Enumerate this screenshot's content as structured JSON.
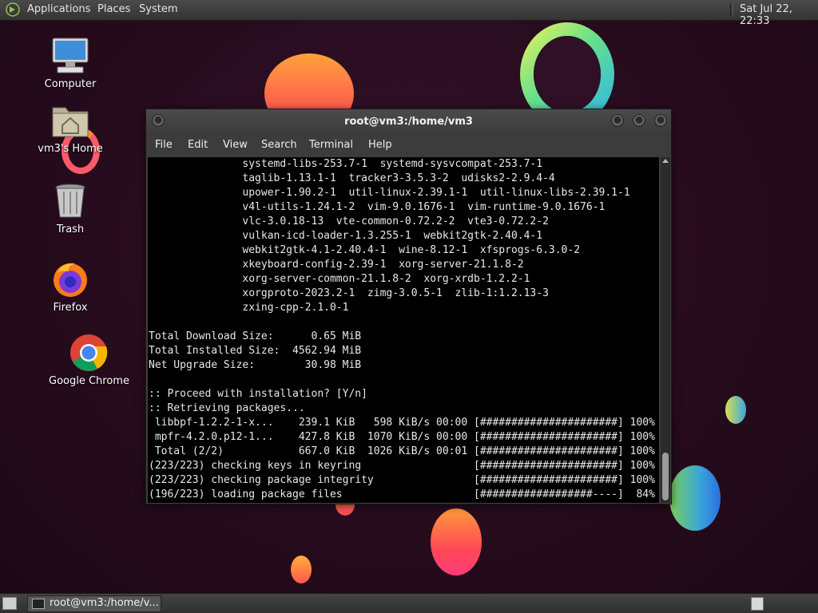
{
  "top_panel": {
    "menus": [
      "Applications",
      "Places",
      "System"
    ],
    "clock": "Sat Jul 22, 22:33"
  },
  "desktop_icons": [
    {
      "label": "Computer",
      "icon": "computer-icon"
    },
    {
      "label": "vm3's Home",
      "icon": "home-folder-icon"
    },
    {
      "label": "Trash",
      "icon": "trash-icon"
    },
    {
      "label": "Firefox",
      "icon": "firefox-icon"
    },
    {
      "label": "Google Chrome",
      "icon": "chrome-icon"
    }
  ],
  "terminal": {
    "title": "root@vm3:/home/vm3",
    "menu": [
      "File",
      "Edit",
      "View",
      "Search",
      "Terminal",
      "Help"
    ],
    "lines": [
      "               systemd-libs-253.7-1  systemd-sysvcompat-253.7-1",
      "               taglib-1.13.1-1  tracker3-3.5.3-2  udisks2-2.9.4-4",
      "               upower-1.90.2-1  util-linux-2.39.1-1  util-linux-libs-2.39.1-1",
      "               v4l-utils-1.24.1-2  vim-9.0.1676-1  vim-runtime-9.0.1676-1",
      "               vlc-3.0.18-13  vte-common-0.72.2-2  vte3-0.72.2-2",
      "               vulkan-icd-loader-1.3.255-1  webkit2gtk-2.40.4-1",
      "               webkit2gtk-4.1-2.40.4-1  wine-8.12-1  xfsprogs-6.3.0-2",
      "               xkeyboard-config-2.39-1  xorg-server-21.1.8-2",
      "               xorg-server-common-21.1.8-2  xorg-xrdb-1.2.2-1",
      "               xorgproto-2023.2-1  zimg-3.0.5-1  zlib-1:1.2.13-3",
      "               zxing-cpp-2.1.0-1",
      "",
      "Total Download Size:      0.65 MiB",
      "Total Installed Size:  4562.94 MiB",
      "Net Upgrade Size:        30.98 MiB",
      "",
      ":: Proceed with installation? [Y/n]",
      ":: Retrieving packages...",
      " libbpf-1.2.2-1-x...    239.1 KiB   598 KiB/s 00:00 [######################] 100%",
      " mpfr-4.2.0.p12-1...    427.8 KiB  1070 KiB/s 00:00 [######################] 100%",
      " Total (2/2)            667.0 KiB  1026 KiB/s 00:01 [######################] 100%",
      "(223/223) checking keys in keyring                  [######################] 100%",
      "(223/223) checking package integrity                [######################] 100%",
      "(196/223) loading package files                     [##################----]  84%"
    ]
  },
  "bottom_panel": {
    "task_label": "root@vm3:/home/v..."
  }
}
